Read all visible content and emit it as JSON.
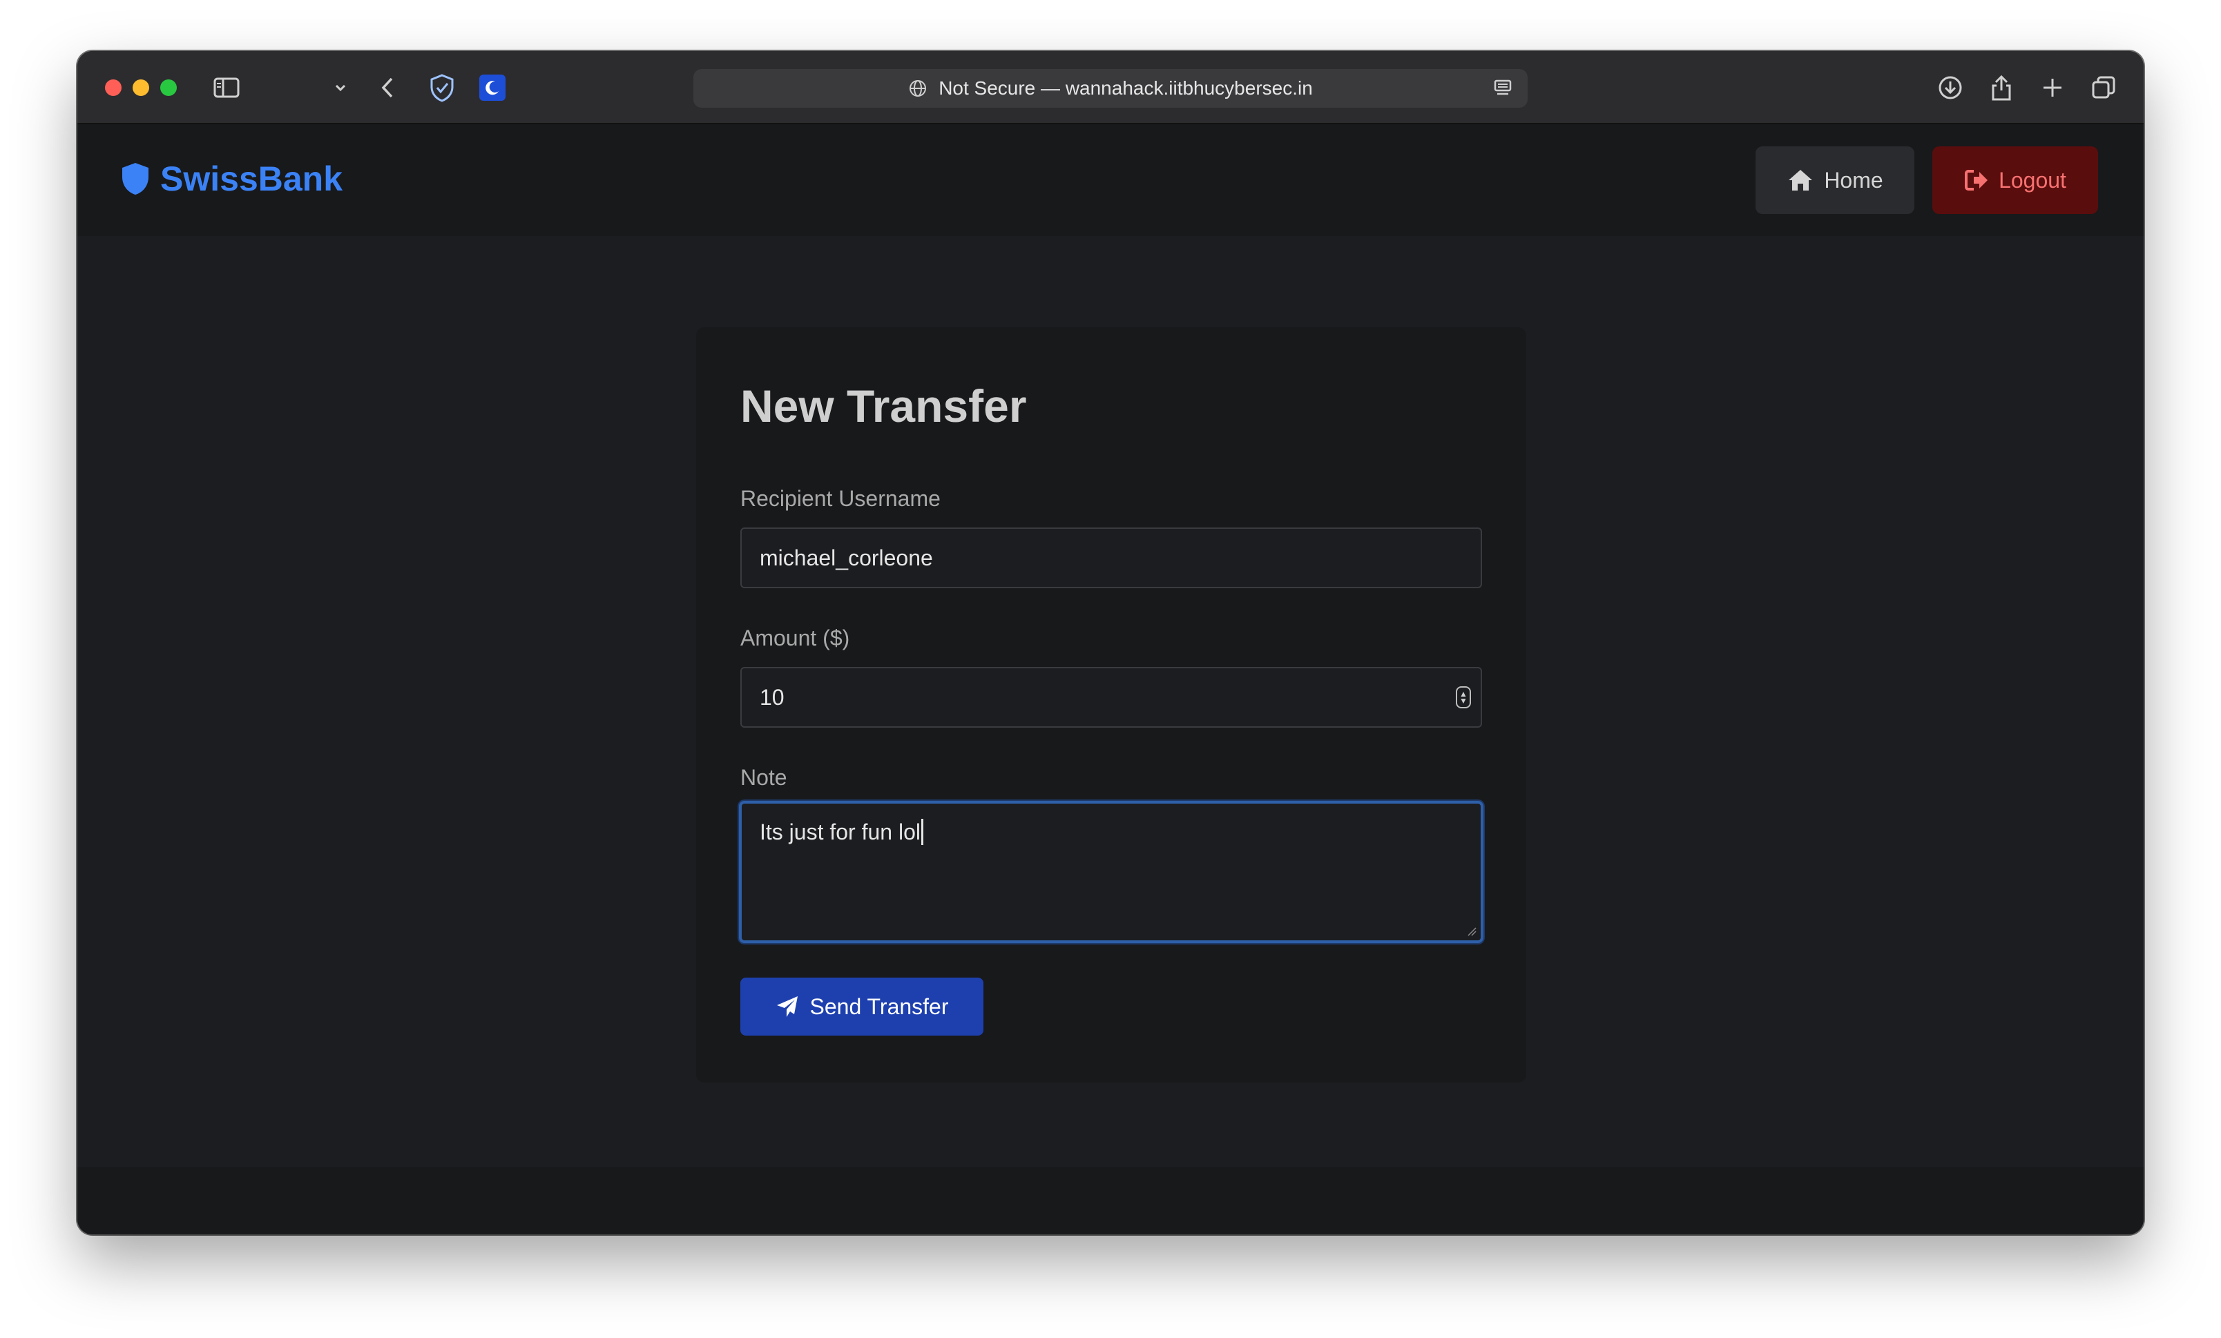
{
  "browser": {
    "url_text": "Not Secure — wannahack.iitbhucybersec.in",
    "icons": [
      "sidebar-icon",
      "chevron-down-icon",
      "back-arrow-icon",
      "shield-check-icon",
      "extension-moon-icon",
      "globe-icon",
      "reader-icon",
      "download-icon",
      "share-icon",
      "plus-icon",
      "tabs-icon"
    ]
  },
  "navbar": {
    "brand": "SwissBank",
    "home_label": "Home",
    "logout_label": "Logout"
  },
  "form": {
    "title": "New Transfer",
    "recipient_label": "Recipient Username",
    "recipient_value": "michael_corleone",
    "amount_label": "Amount ($)",
    "amount_value": "10",
    "note_label": "Note",
    "note_value": "Its just for fun lol",
    "submit_label": "Send Transfer"
  },
  "colors": {
    "brand": "#3b82f6",
    "primary_button": "#1e40af",
    "logout_bg": "#5a0d0d",
    "logout_text": "#f87171",
    "focus_border": "#2e5fa8"
  }
}
